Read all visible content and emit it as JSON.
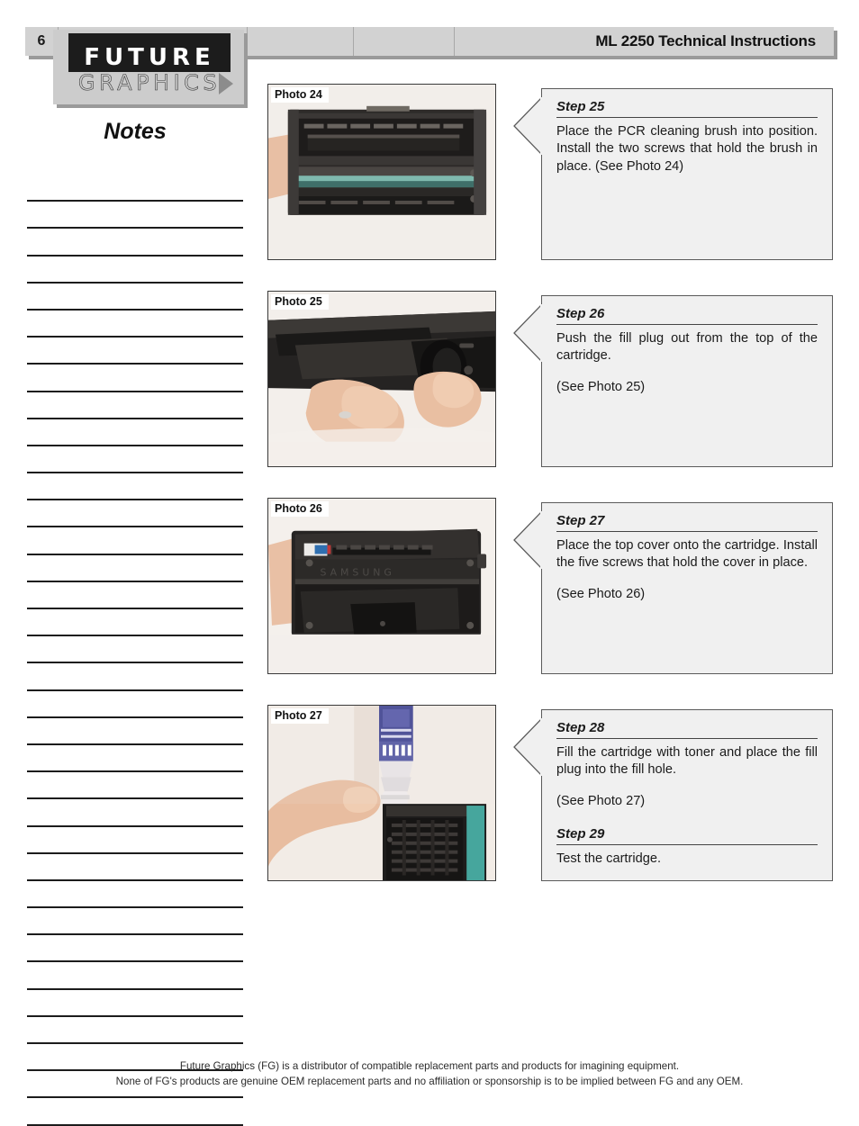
{
  "header": {
    "page_number": "6",
    "title": "ML 2250 Technical Instructions"
  },
  "logo": {
    "line1": "FUTURE",
    "line2": "GRAPHICS"
  },
  "notes": {
    "title": "Notes",
    "line_count": 35
  },
  "rows": [
    {
      "photo_label": "Photo 24",
      "photo_alt": "Toner cartridge with drum and PCR cleaning brush area exposed",
      "steps": [
        {
          "heading": "Step 25",
          "body": "Place the PCR cleaning brush into position. Install the two screws that hold the brush in place. (See Photo 24)",
          "reference": ""
        }
      ]
    },
    {
      "photo_label": "Photo 25",
      "photo_alt": "Hands pushing the fill plug out from the top of the cartridge",
      "steps": [
        {
          "heading": "Step 26",
          "body": "Push the fill plug out from the top of the cartridge.",
          "reference": "(See Photo 25)"
        }
      ]
    },
    {
      "photo_label": "Photo 26",
      "photo_alt": "Top cover placed onto the assembled cartridge",
      "steps": [
        {
          "heading": "Step 27",
          "body": "Place the top cover onto the cartridge. Install the five screws that hold the cover in place.",
          "reference": "(See Photo 26)"
        }
      ]
    },
    {
      "photo_label": "Photo 27",
      "photo_alt": "Hand holding a toner bottle filling the cartridge through the fill hole",
      "steps": [
        {
          "heading": "Step 28",
          "body": "Fill the cartridge with toner and place the fill plug into the fill hole.",
          "reference": "(See Photo 27)"
        },
        {
          "heading": "Step 29",
          "body": "Test the cartridge.",
          "reference": ""
        }
      ]
    }
  ],
  "footer": {
    "line1": "Future Graphics (FG) is a distributor of compatible replacement parts and products for imagining equipment.",
    "line2": "None of FG's products are genuine OEM replacement parts and no affiliation or sponsorship is to be implied between FG and any OEM."
  },
  "colors": {
    "header_bar": "#d2d2d2",
    "header_shadow": "#9a9a9a",
    "logo_block": "#cccccc",
    "logo_bar": "#1c1c1c",
    "step_box_bg": "#f0f0f0",
    "step_box_border": "#5a5a5a",
    "rule": "#1c1c1c"
  }
}
